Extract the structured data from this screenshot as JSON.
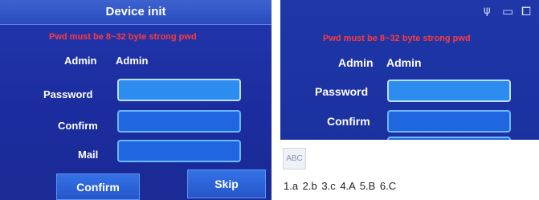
{
  "left_screen": {
    "title": "Device init",
    "warning": "Pwd must be 8~32 byte strong pwd",
    "admin_label": "Admin",
    "admin_value": "Admin",
    "password_label": "Password",
    "confirm_label": "Confirm",
    "mail_label": "Mail",
    "confirm_button": "Confirm",
    "skip_button": "Skip"
  },
  "right_screen": {
    "status_icons": [
      "usb-icon",
      "sd-card-icon",
      "window-icon"
    ],
    "status_glyphs": {
      "usb": "ψ",
      "sd": "▭",
      "win": "⧠"
    },
    "warning": "Pwd must be 8~32 byte strong pwd",
    "admin_label": "Admin",
    "admin_value": "Admin",
    "password_label": "Password",
    "confirm_label": "Confirm",
    "keyboard_mode": "ABC",
    "candidates": "1.a  2.b  3.c  4.A  5.B  6.C"
  },
  "colors": {
    "background": "#1b2f9c",
    "warning": "#ff3b3b",
    "field": "#1e67e0",
    "field_border": "#6fb6ff"
  }
}
